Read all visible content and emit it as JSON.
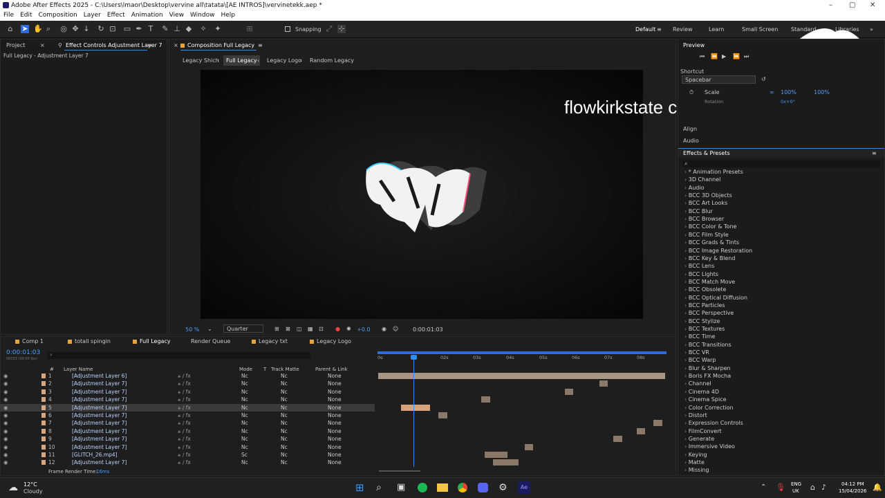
{
  "window": {
    "title": "Adobe After Effects 2025 - C:\\Users\\lmaor\\Desktop\\vervine all\\tatata\\[AE INTROS]\\vervinetekk.aep *"
  },
  "menu": [
    "File",
    "Edit",
    "Composition",
    "Layer",
    "Effect",
    "Animation",
    "View",
    "Window",
    "Help"
  ],
  "toolbar": {
    "snapping": "Snapping"
  },
  "workspaces": [
    "Default",
    "Review",
    "Learn",
    "Small Screen",
    "Standard",
    "Libraries"
  ],
  "left_panel": {
    "tab_project": "Project",
    "tab_effect_controls": "Effect Controls Adjustment Layer 7",
    "subtitle": "Full Legacy - Adjustment Layer 7"
  },
  "comp_panel": {
    "tab": "Composition Full Legacy",
    "breadcrumbs": [
      "Legacy Shich",
      "Full Legacy",
      "Legacy Logo",
      "Random Legacy"
    ],
    "zoom": "50 %",
    "resolution": "Quarter",
    "exposure": "+0.0",
    "timecode": "0:00:01:03"
  },
  "overlay_text": "flowkirkstate chicken fried rice",
  "preview": {
    "title": "Preview",
    "shortcut_label": "Shortcut",
    "shortcut_value": "Spacebar",
    "scale_label": "Scale",
    "scale_x": "100%",
    "scale_y": "100%",
    "rotation_label": "Rotation",
    "rotation_value": "0x+0°"
  },
  "right_sections": {
    "align": "Align",
    "audio": "Audio",
    "effects_presets": "Effects & Presets",
    "search_placeholder": "⌕"
  },
  "effects": [
    "* Animation Presets",
    "3D Channel",
    "Audio",
    "BCC 3D Objects",
    "BCC Art Looks",
    "BCC Blur",
    "BCC Browser",
    "BCC Color & Tone",
    "BCC Film Style",
    "BCC Grads & Tints",
    "BCC Image Restoration",
    "BCC Key & Blend",
    "BCC Lens",
    "BCC Lights",
    "BCC Match Move",
    "BCC Obsolete",
    "BCC Optical Diffusion",
    "BCC Particles",
    "BCC Perspective",
    "BCC Stylize",
    "BCC Textures",
    "BCC Time",
    "BCC Transitions",
    "BCC VR",
    "BCC Warp",
    "Blur & Sharpen",
    "Boris FX Mocha",
    "Channel",
    "Cinema 4D",
    "Cinema Spice",
    "Color Correction",
    "Distort",
    "Expression Controls",
    "FilmConvert",
    "Generate",
    "Immersive Video",
    "Keying",
    "Matte",
    "Missing"
  ],
  "timeline_tabs": [
    "Comp 1",
    "totall spingin",
    "Full Legacy",
    "Render Queue",
    "Legacy txt",
    "Legacy Logo"
  ],
  "timeline": {
    "timecode": "0:00:01:03",
    "fps": "00033 (30.00 fps)",
    "headers": {
      "num": "#",
      "name": "Layer Name",
      "mode": "Mode",
      "t": "T",
      "track_matte": "Track Matte",
      "parent": "Parent & Link"
    },
    "ticks": [
      "0s",
      "02s",
      "03s",
      "04s",
      "05s",
      "06s",
      "07s",
      "08s"
    ],
    "frame_render_label": "Frame Render Time:",
    "frame_render_value": "16ms",
    "layers": [
      {
        "num": "1",
        "name": "[Adjustment Layer 6]",
        "mode": "Nc",
        "tm": "Nc",
        "parent": "None",
        "bar_start": 0.0,
        "bar_end": 1.0
      },
      {
        "num": "2",
        "name": "[Adjustment Layer 7]",
        "mode": "Nc",
        "tm": "Nc",
        "parent": "None",
        "bar_start": 0.77,
        "bar_end": 0.8
      },
      {
        "num": "3",
        "name": "[Adjustment Layer 7]",
        "mode": "Nc",
        "tm": "Nc",
        "parent": "None",
        "bar_start": 0.65,
        "bar_end": 0.68
      },
      {
        "num": "4",
        "name": "[Adjustment Layer 7]",
        "mode": "Nc",
        "tm": "Nc",
        "parent": "None",
        "bar_start": 0.36,
        "bar_end": 0.39
      },
      {
        "num": "5",
        "name": "[Adjustment Layer 7]",
        "mode": "Nc",
        "tm": "Nc",
        "parent": "None",
        "bar_start": 0.08,
        "bar_end": 0.18
      },
      {
        "num": "6",
        "name": "[Adjustment Layer 7]",
        "mode": "Nc",
        "tm": "Nc",
        "parent": "None",
        "bar_start": 0.21,
        "bar_end": 0.24
      },
      {
        "num": "7",
        "name": "[Adjustment Layer 7]",
        "mode": "Nc",
        "tm": "Nc",
        "parent": "None",
        "bar_start": 0.96,
        "bar_end": 0.99
      },
      {
        "num": "8",
        "name": "[Adjustment Layer 7]",
        "mode": "Nc",
        "tm": "Nc",
        "parent": "None",
        "bar_start": 0.9,
        "bar_end": 0.93
      },
      {
        "num": "9",
        "name": "[Adjustment Layer 7]",
        "mode": "Nc",
        "tm": "Nc",
        "parent": "None",
        "bar_start": 0.82,
        "bar_end": 0.85
      },
      {
        "num": "10",
        "name": "[Adjustment Layer 7]",
        "mode": "Nc",
        "tm": "Nc",
        "parent": "None",
        "bar_start": 0.51,
        "bar_end": 0.54
      },
      {
        "num": "11",
        "name": "[GLITCH_26.mp4]",
        "mode": "Sc",
        "tm": "Nc",
        "parent": "None",
        "bar_start": 0.37,
        "bar_end": 0.45
      },
      {
        "num": "12",
        "name": "[Adjustment Layer 7]",
        "mode": "Nc",
        "tm": "Nc",
        "parent": "None",
        "bar_start": 0.4,
        "bar_end": 0.49
      }
    ]
  },
  "taskbar": {
    "temp": "12°C",
    "weather": "Cloudy",
    "lang": "ENG",
    "region": "UK",
    "time": "04:12 PM",
    "date": "15/04/2026"
  }
}
